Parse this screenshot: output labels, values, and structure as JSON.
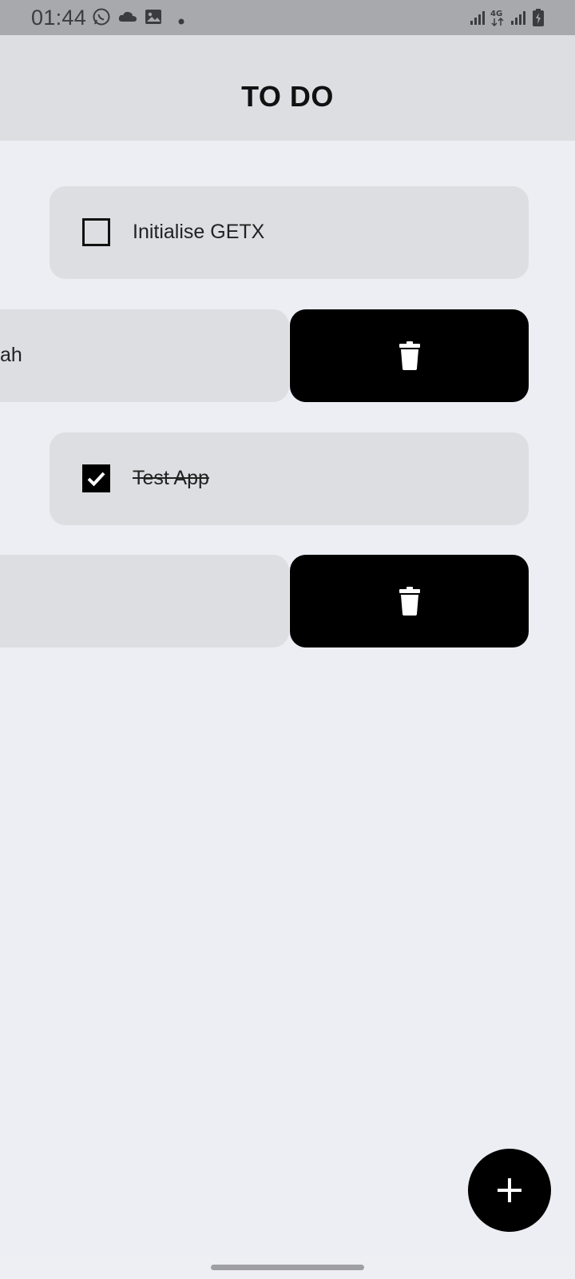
{
  "status_bar": {
    "time": "01:44",
    "left_icons": [
      "whatsapp-icon",
      "cloud-icon",
      "gallery-icon",
      "dot-icon"
    ],
    "right_icons": [
      "signal-icon",
      "4g-icon",
      "signal-icon",
      "battery-charging-icon"
    ]
  },
  "app_bar": {
    "title": "TO DO"
  },
  "todos": [
    {
      "label": "Initialise GETX",
      "checked": false,
      "swiped": false
    },
    {
      "label": "ah",
      "checked": null,
      "swiped": true,
      "action_icon": "trash-icon"
    },
    {
      "label": "Test App",
      "checked": true,
      "swiped": false
    },
    {
      "label": "",
      "checked": null,
      "swiped": true,
      "action_icon": "trash-icon"
    }
  ],
  "fab": {
    "icon": "plus-icon"
  },
  "colors": {
    "background": "#edeef3",
    "tile": "#dddee2",
    "status_bar": "#a8a9ad",
    "accent": "#000000"
  }
}
